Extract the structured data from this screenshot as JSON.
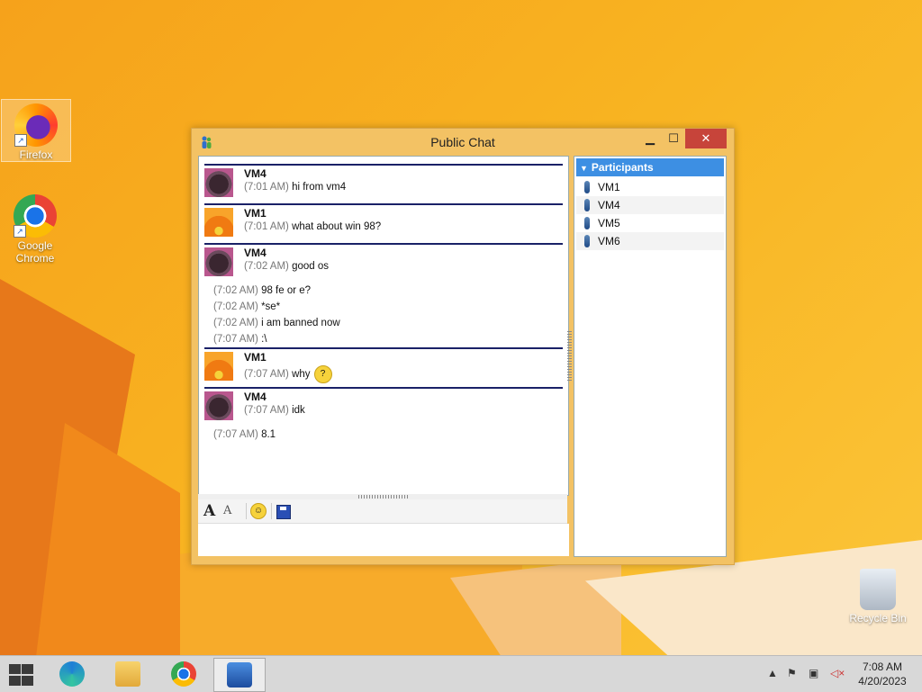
{
  "desktop": {
    "icons": [
      {
        "label": "Firefox"
      },
      {
        "label": "Google Chrome"
      },
      {
        "label": "Recycle Bin"
      }
    ]
  },
  "window": {
    "title": "Public Chat",
    "controls": {
      "minimize": "▁",
      "maximize": "☐",
      "close": "✕"
    }
  },
  "chat": {
    "messages": [
      {
        "sender": "VM4",
        "avatar": "vm4",
        "lines": [
          {
            "time": "(7:01 AM)",
            "text": "hi from vm4"
          }
        ]
      },
      {
        "sender": "VM1",
        "avatar": "vm1",
        "lines": [
          {
            "time": "(7:01 AM)",
            "text": "what about win 98?"
          }
        ]
      },
      {
        "sender": "VM4",
        "avatar": "vm4",
        "lines": [
          {
            "time": "(7:02 AM)",
            "text": "good os"
          },
          {
            "time": "(7:02 AM)",
            "text": "98 fe or e?"
          },
          {
            "time": "(7:02 AM)",
            "text": "*se*"
          },
          {
            "time": "(7:02 AM)",
            "text": "i am banned now"
          },
          {
            "time": "(7:07 AM)",
            "text": ":\\"
          }
        ]
      },
      {
        "sender": "VM1",
        "avatar": "vm1",
        "lines": [
          {
            "time": "(7:07 AM)",
            "text": "why",
            "emoji": "thinking-emoji"
          }
        ]
      },
      {
        "sender": "VM4",
        "avatar": "vm4",
        "lines": [
          {
            "time": "(7:07 AM)",
            "text": "idk"
          },
          {
            "time": "(7:07 AM)",
            "text": "8.1"
          }
        ]
      }
    ]
  },
  "toolbar": {
    "font_label": "A",
    "format_label": "A",
    "emoticon_icon": "smiley-icon",
    "save_icon": "floppy-disk-icon"
  },
  "input": {
    "value": ""
  },
  "participants": {
    "header": "Participants",
    "items": [
      "VM1",
      "VM4",
      "VM5",
      "VM6"
    ]
  },
  "taskbar": {
    "apps": [
      "start-icon",
      "edge-icon",
      "file-explorer-icon",
      "chrome-icon",
      "messenger-icon"
    ],
    "clock": {
      "time": "7:08 AM",
      "date": "4/20/2023"
    }
  },
  "colors": {
    "accent": "#3d8fe3",
    "window_frame": "#f3c264",
    "close_button": "#c7443a",
    "message_divider": "#1a2167"
  }
}
